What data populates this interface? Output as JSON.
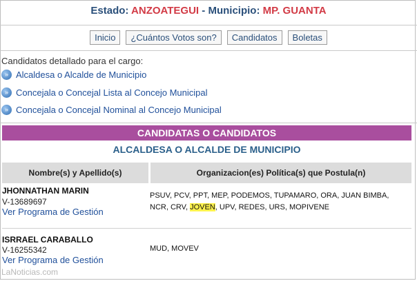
{
  "header": {
    "estado_label": "Estado:",
    "estado_value": "ANZOATEGUI",
    "dash": "-",
    "municipio_label": "Municipio:",
    "municipio_value": "MP. GUANTA"
  },
  "nav": {
    "items": [
      "Inicio",
      "¿Cuántos Votos son?",
      "Candidatos",
      "Boletas"
    ]
  },
  "detail": {
    "title": "Candidatos detallado para el cargo:",
    "links": [
      "Alcaldesa o Alcalde de Municipio",
      "Concejala o Concejal Lista al Concejo Municipal",
      "Concejala o Concejal Nominal al Concejo Municipal"
    ]
  },
  "section": {
    "banner": "CANDIDATAS O CANDIDATOS",
    "subtitle": "ALCALDESA O ALCALDE DE MUNICIPIO"
  },
  "table": {
    "headers": [
      "Nombre(s) y Apellido(s)",
      "Organizacion(es) Política(s) que Postula(n)"
    ],
    "rows": [
      {
        "name": "JHONNATHAN MARIN",
        "id": "V-13689697",
        "link": "Ver Programa de Gestión",
        "orgs_line1": "PSUV, PCV, PPT, MEP, PODEMOS, TUPAMARO, ORA, JUAN BIMBA,",
        "orgs_line2_pre": "NCR, CRV, ",
        "orgs_highlight": "JOVEN",
        "orgs_line2_post": ", UPV, REDES, URS, MOPIVENE"
      },
      {
        "name": "ISRRAEL CARABALLO",
        "id": "V-16255342",
        "link": "Ver Programa de Gestión",
        "orgs_line1": "MUD, MOVEV"
      }
    ]
  },
  "watermark": "LaNoticias.com",
  "colors": {
    "banner": "#a94e9e",
    "header_red": "#d23a45",
    "header_blue": "#2a4f7a",
    "link": "#1f4f9a",
    "highlight": "#fff34d"
  }
}
